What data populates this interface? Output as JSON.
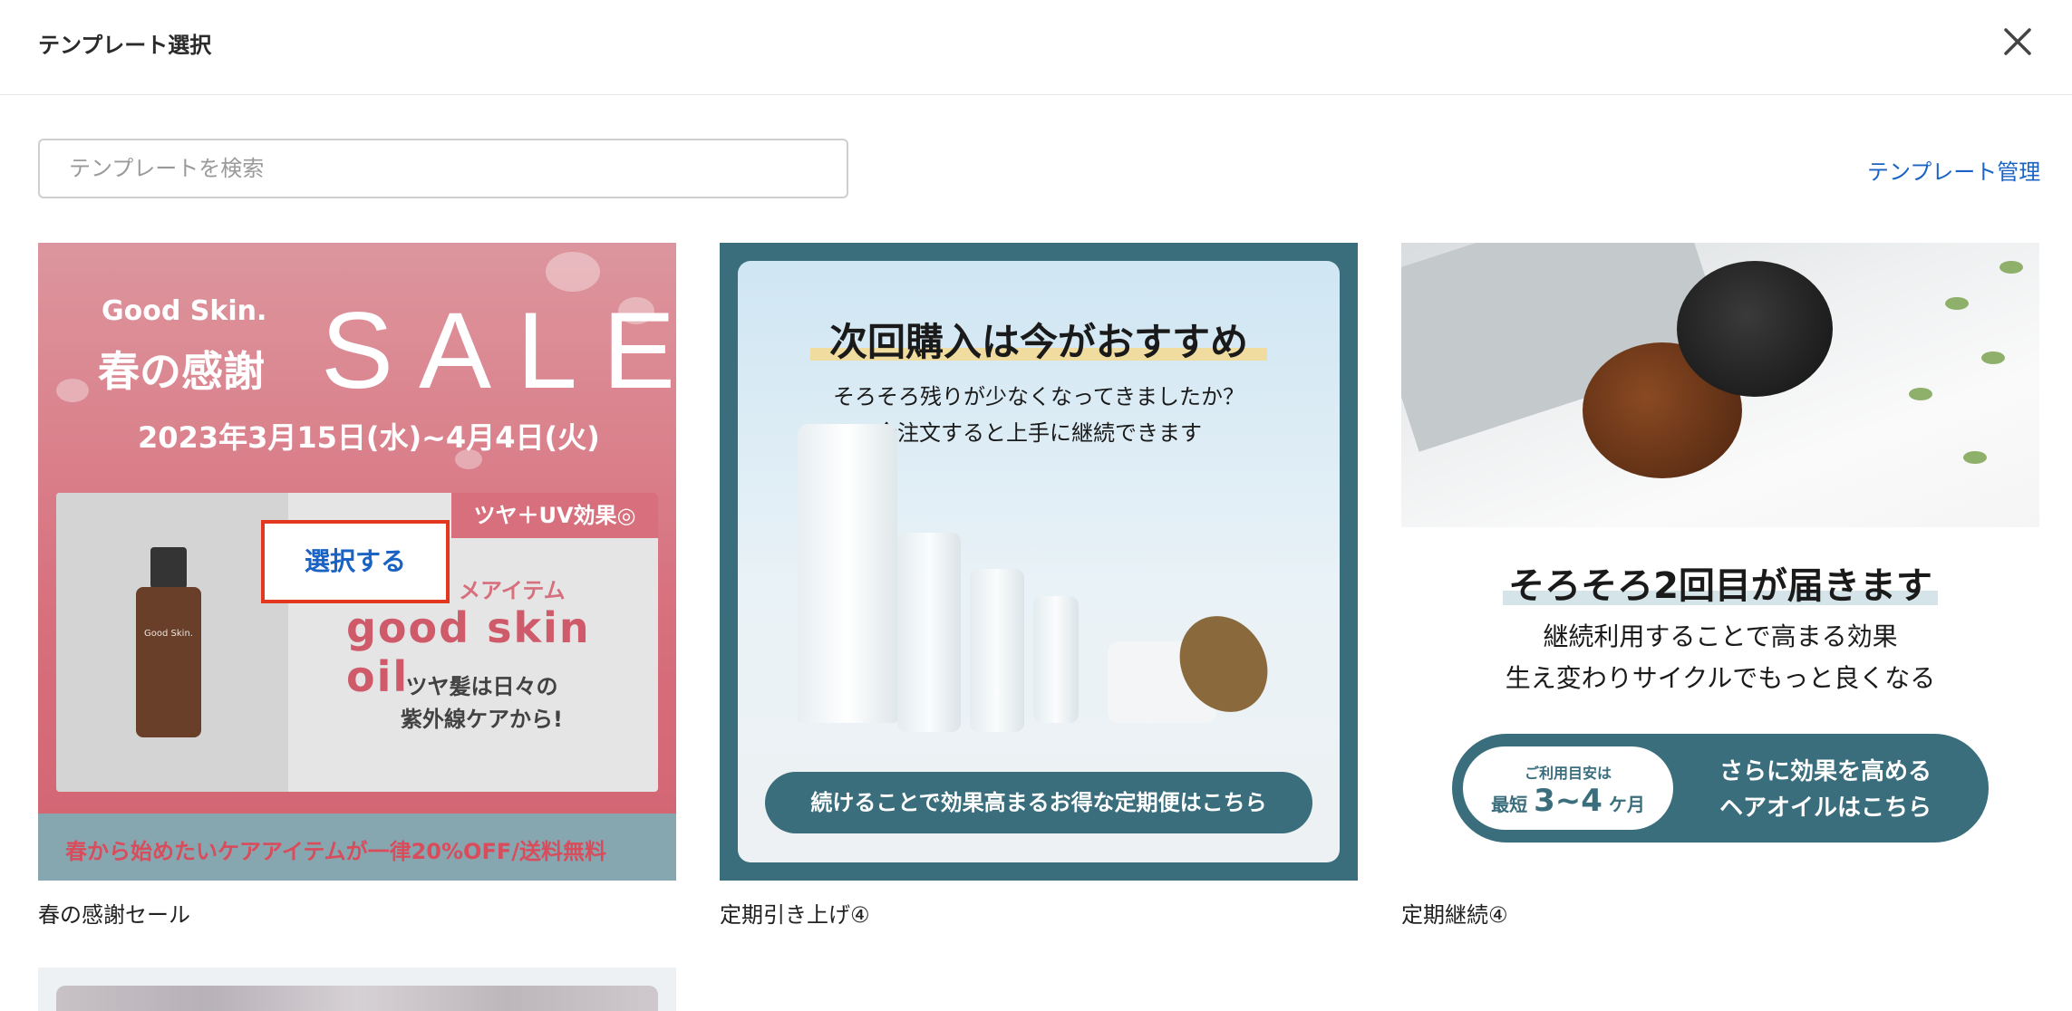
{
  "header": {
    "title": "テンプレート選択",
    "close_icon": "close-icon"
  },
  "search": {
    "placeholder": "テンプレートを検索",
    "value": ""
  },
  "manage_link": "テンプレート管理",
  "select_button": "選択する",
  "colors": {
    "accent_link": "#1a63c4",
    "select_border": "#e3371e",
    "teal": "#3a6e7c",
    "sale_pink": "#d35f6e"
  },
  "templates": [
    {
      "label": "春の感謝セール",
      "banner": {
        "brand": "Good Skin.",
        "title": "春の感謝",
        "sale": "SALE",
        "dates": "2023年3月15日(水)~4月4日(火)",
        "badge": "ツヤ＋UV効果◎",
        "item_head": "メアイテム",
        "product": "good skin oil",
        "tagline_1": "ツヤ髪は日々の",
        "tagline_2": "紫外線ケアから!",
        "bottle_label": "Good Skin.",
        "footer": "春から始めたいケアアイテムが一律20%OFF/送料無料"
      }
    },
    {
      "label": "定期引き上げ④",
      "banner": {
        "headline": "次回購入は今がおすすめ",
        "sub_1": "そろそろ残りが少なくなってきましたか？",
        "sub_2": "今注文すると上手に継続できます",
        "cta": "続けることで効果高まるお得な定期便はこちら"
      }
    },
    {
      "label": "定期継続④",
      "banner": {
        "headline": "そろそろ2回目が届きます",
        "sub_1": "継続利用することで高まる効果",
        "sub_2": "生え変わりサイクルでもっと良くなる",
        "pill_small": "ご利用目安は",
        "pill_prefix": "最短",
        "pill_big": "3~4",
        "pill_suffix": "ケ月",
        "cta_1": "さらに効果を高める",
        "cta_2": "ヘアオイルはこちら"
      }
    }
  ]
}
